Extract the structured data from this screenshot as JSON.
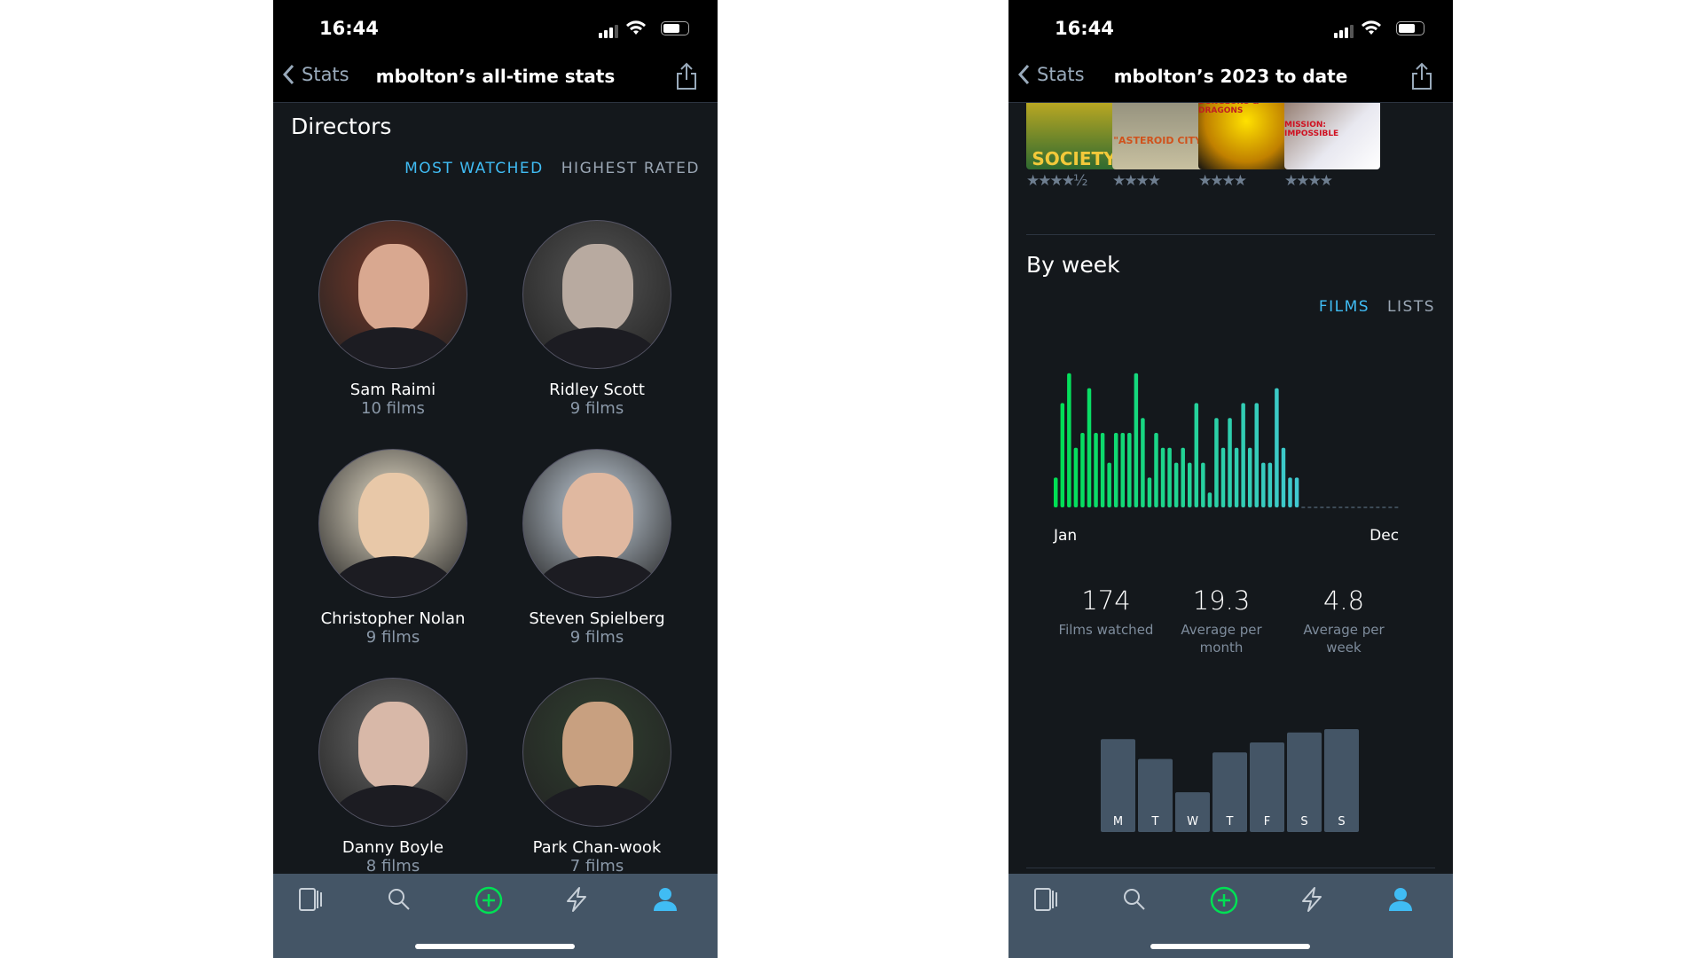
{
  "status": {
    "time": "16:44"
  },
  "left": {
    "nav": {
      "back": "Stats",
      "title": "mbolton’s all-time stats"
    },
    "section": "Directors",
    "tabs": [
      {
        "label": "MOST WATCHED",
        "active": true
      },
      {
        "label": "HIGHEST RATED",
        "active": false
      }
    ],
    "directors": [
      {
        "name": "Sam Raimi",
        "count": "10 films"
      },
      {
        "name": "Ridley Scott",
        "count": "9 films"
      },
      {
        "name": "Christopher Nolan",
        "count": "9 films"
      },
      {
        "name": "Steven Spielberg",
        "count": "9 films"
      },
      {
        "name": "Danny Boyle",
        "count": "8 films"
      },
      {
        "name": "Park Chan-wook",
        "count": "7 films"
      }
    ]
  },
  "right": {
    "nav": {
      "back": "Stats",
      "title": "mbolton’s 2023 to date"
    },
    "posters": [
      {
        "title": "SOCIETY",
        "rating": "★★★★½"
      },
      {
        "title": "\"ASTEROID CITY\"",
        "rating": "★★★★"
      },
      {
        "title": "DUNGEONS & DRAGONS",
        "rating": "★★★★"
      },
      {
        "title": "MISSION: IMPOSSIBLE",
        "rating": "★★★★"
      }
    ],
    "section": "By week",
    "tabs": [
      {
        "label": "FILMS",
        "active": true
      },
      {
        "label": "LISTS",
        "active": false
      }
    ],
    "stats": [
      {
        "value": "174",
        "label": "Films watched"
      },
      {
        "value": "19.3",
        "label": "Average per month"
      },
      {
        "value": "4.8",
        "label": "Average per week"
      }
    ]
  },
  "chart_data": [
    {
      "type": "bar",
      "xlabel": "",
      "ylabel": "",
      "x_tick_labels": [
        "Jan",
        "Dec"
      ],
      "total_weeks": 52,
      "values": [
        2,
        7,
        9,
        4,
        5,
        8,
        5,
        5,
        3,
        5,
        5,
        5,
        9,
        6,
        2,
        5,
        4,
        4,
        3,
        4,
        3,
        7,
        3,
        1,
        6,
        4,
        6,
        4,
        7,
        4,
        7,
        3,
        3,
        8,
        4,
        2,
        2
      ],
      "colors": {
        "start": "#00e054",
        "end": "#40c8d0"
      }
    },
    {
      "type": "bar",
      "categories": [
        "M",
        "T",
        "W",
        "T",
        "F",
        "S",
        "S"
      ],
      "values": [
        28,
        22,
        12,
        24,
        27,
        30,
        31
      ],
      "color": "#445566"
    }
  ],
  "tabbar": [
    {
      "icon": "films-icon"
    },
    {
      "icon": "search-icon"
    },
    {
      "icon": "add-icon",
      "color": "#00e054"
    },
    {
      "icon": "activity-icon"
    },
    {
      "icon": "profile-icon",
      "color": "#40bcf4"
    }
  ]
}
